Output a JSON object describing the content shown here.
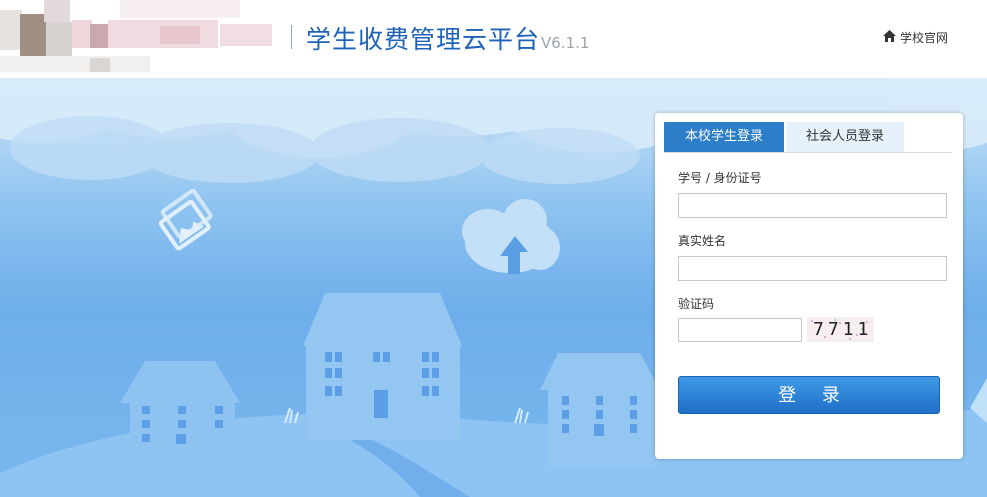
{
  "header": {
    "title": "学生收费管理云平台",
    "version": "V6.1.1",
    "home_link": "学校官网",
    "home_icon": "home-icon"
  },
  "login": {
    "tabs": [
      {
        "label": "本校学生登录",
        "active": true
      },
      {
        "label": "社会人员登录",
        "active": false
      }
    ],
    "student_id_label": "学号 / 身份证号",
    "student_id_value": "",
    "name_label": "真实姓名",
    "name_value": "",
    "captcha_label": "验证码",
    "captcha_value": "",
    "captcha_text": "7711",
    "submit_label": "登 录"
  },
  "colors": {
    "brand_blue": "#1e63b8",
    "tab_active": "#2c7ec8",
    "button": "#2a80d6"
  }
}
